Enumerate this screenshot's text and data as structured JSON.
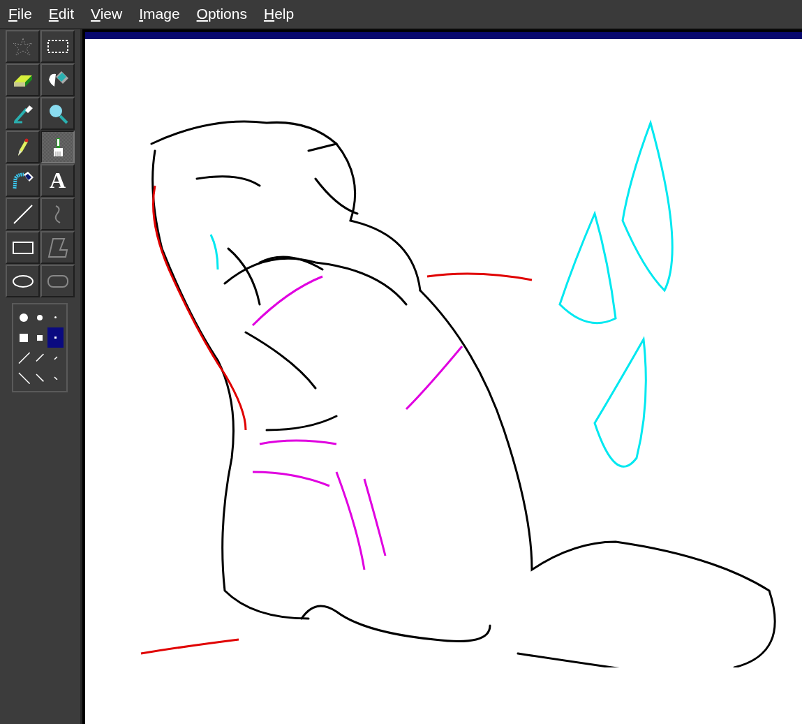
{
  "menu": [
    {
      "label": "File"
    },
    {
      "label": "Edit"
    },
    {
      "label": "View"
    },
    {
      "label": "Image"
    },
    {
      "label": "Options"
    },
    {
      "label": "Help"
    }
  ],
  "tools": [
    {
      "kind": "free-select",
      "selected": false
    },
    {
      "kind": "select",
      "selected": false
    },
    {
      "kind": "eraser",
      "selected": false
    },
    {
      "kind": "fill",
      "selected": false
    },
    {
      "kind": "picker",
      "selected": false
    },
    {
      "kind": "magnifier",
      "selected": false
    },
    {
      "kind": "pencil",
      "selected": false
    },
    {
      "kind": "brush",
      "selected": true
    },
    {
      "kind": "airbrush",
      "selected": false
    },
    {
      "kind": "text",
      "selected": false
    },
    {
      "kind": "line",
      "selected": false
    },
    {
      "kind": "curve",
      "selected": false
    },
    {
      "kind": "rectangle",
      "selected": false
    },
    {
      "kind": "polygon",
      "selected": false
    },
    {
      "kind": "ellipse",
      "selected": false
    },
    {
      "kind": "rounded-rectangle",
      "selected": false
    }
  ],
  "brush_shapes": [
    {
      "kind": "circle-large",
      "selected": false
    },
    {
      "kind": "circle-medium",
      "selected": false
    },
    {
      "kind": "circle-small",
      "selected": false
    },
    {
      "kind": "square-large",
      "selected": false
    },
    {
      "kind": "square-medium",
      "selected": false
    },
    {
      "kind": "square-small",
      "selected": true
    },
    {
      "kind": "slash-large",
      "selected": false
    },
    {
      "kind": "slash-medium",
      "selected": false
    },
    {
      "kind": "slash-small",
      "selected": false
    },
    {
      "kind": "backslash-large",
      "selected": false
    },
    {
      "kind": "backslash-medium",
      "selected": false
    },
    {
      "kind": "backslash-small",
      "selected": false
    }
  ],
  "text_tool_glyph": "A"
}
